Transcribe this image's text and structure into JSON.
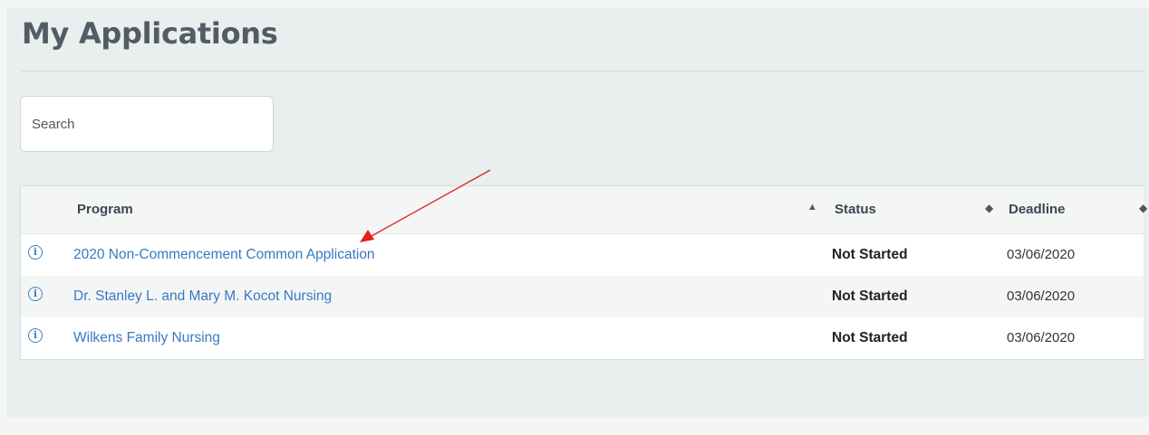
{
  "page": {
    "title": "My Applications"
  },
  "search": {
    "placeholder": "Search"
  },
  "table": {
    "headers": {
      "program": "Program",
      "status": "Status",
      "deadline": "Deadline"
    },
    "rows": [
      {
        "program": "2020 Non-Commencement Common Application",
        "status": "Not Started",
        "deadline": "03/06/2020"
      },
      {
        "program": "Dr. Stanley L. and Mary M. Kocot Nursing",
        "status": "Not Started",
        "deadline": "03/06/2020"
      },
      {
        "program": "Wilkens Family Nursing",
        "status": "Not Started",
        "deadline": "03/06/2020"
      }
    ]
  },
  "icons": {
    "info": "info-icon",
    "sort_asc": "sort-asc-icon",
    "sort_both": "sort-both-icon"
  },
  "colors": {
    "link": "#3a78c2",
    "annotation_arrow": "#e02020",
    "background": "#e9eeee"
  }
}
